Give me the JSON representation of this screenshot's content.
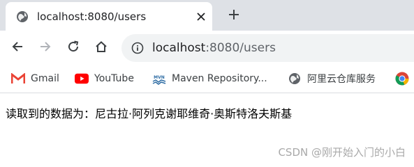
{
  "tab": {
    "title": "localhost:8080/users",
    "favicon": "globe-icon",
    "close_icon": "close-icon"
  },
  "new_tab_icon": "plus-icon",
  "toolbar": {
    "back_icon": "arrow-left-icon",
    "forward_icon": "arrow-right-icon",
    "reload_icon": "reload-icon",
    "home_icon": "home-icon"
  },
  "omnibox": {
    "info_icon": "info-icon",
    "url_host": "localhost",
    "url_rest": ":8080/users"
  },
  "bookmarks": [
    {
      "label": "Gmail",
      "icon": "gmail-icon"
    },
    {
      "label": "YouTube",
      "icon": "youtube-icon"
    },
    {
      "label": "Maven Repository...",
      "icon": "maven-icon"
    },
    {
      "label": "阿里云仓库服务",
      "icon": "globe-icon"
    },
    {
      "label": "",
      "icon": "chrome-icon"
    }
  ],
  "page": {
    "text": "读取到的数据为：尼古拉·阿列克谢耶维奇·奥斯特洛夫斯基"
  },
  "watermark": "CSDN @刚开始入门的小白",
  "colors": {
    "tab_strip": "#dee1e6",
    "omnibox_bg": "#f1f3f4",
    "gmail_red": "#EA4335",
    "youtube_red": "#FF0000",
    "maven_blue": "#2E6DA4"
  }
}
